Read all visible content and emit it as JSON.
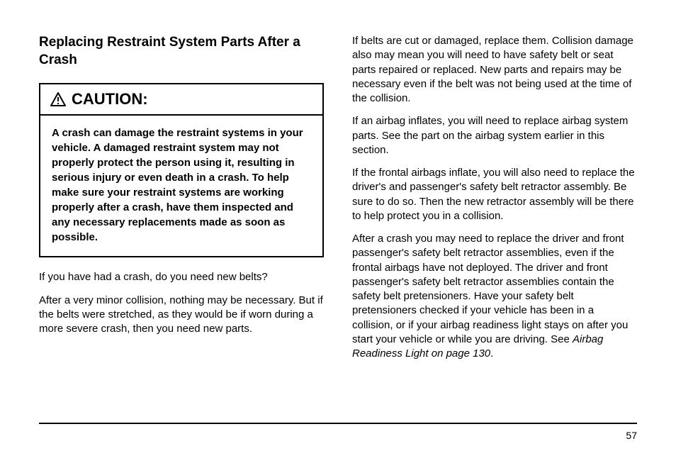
{
  "section_title": "Replacing Restraint System Parts After a Crash",
  "caution": {
    "label": "CAUTION:",
    "body": "A crash can damage the restraint systems in your vehicle. A damaged restraint system may not properly protect the person using it, resulting in serious injury or even death in a crash. To help make sure your restraint systems are working properly after a crash, have them inspected and any necessary replacements made as soon as possible."
  },
  "left_paragraphs": [
    "If you have had a crash, do you need new belts?",
    "After a very minor collision, nothing may be necessary. But if the belts were stretched, as they would be if worn during a more severe crash, then you need new parts."
  ],
  "right_paragraphs": [
    "If belts are cut or damaged, replace them. Collision damage also may mean you will need to have safety belt or seat parts repaired or replaced. New parts and repairs may be necessary even if the belt was not being used at the time of the collision.",
    "If an airbag inflates, you will need to replace airbag system parts. See the part on the airbag system earlier in this section.",
    "If the frontal airbags inflate, you will also need to replace the driver's and passenger's safety belt retractor assembly. Be sure to do so. Then the new retractor assembly will be there to help protect you in a collision."
  ],
  "right_final": {
    "pre": "After a crash you may need to replace the driver and front passenger's safety belt retractor assemblies, even if the frontal airbags have not deployed. The driver and front passenger's safety belt retractor assemblies contain the safety belt pretensioners. Have your safety belt pretensioners checked if your vehicle has been in a collision, or if your airbag readiness light stays on after you start your vehicle or while you are driving. See ",
    "ref": "Airbag Readiness Light on page 130",
    "post": "."
  },
  "page_number": "57"
}
